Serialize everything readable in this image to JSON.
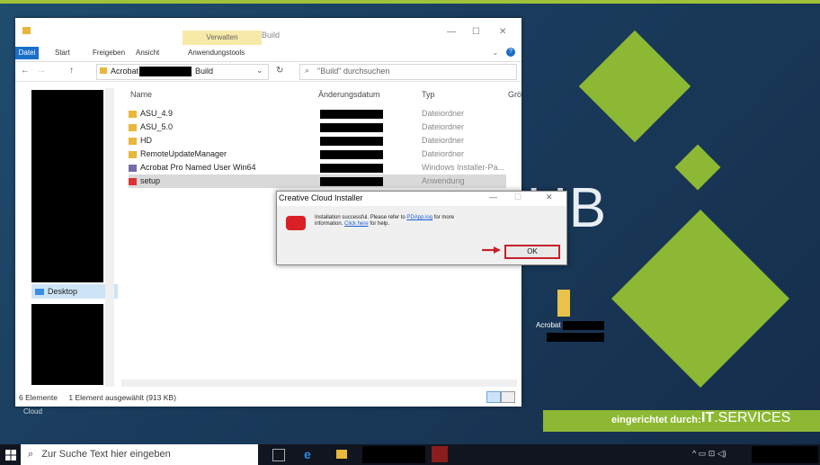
{
  "explorer": {
    "title": "Build",
    "manage_tab": "Verwalten",
    "tabs": [
      "Datei",
      "Start",
      "Freigeben",
      "Ansicht",
      "Anwendungstools"
    ],
    "address_root": "Acrobat",
    "address_current": "Build",
    "search_placeholder": "\"Build\" durchsuchen",
    "columns": {
      "name": "Name",
      "date": "Änderungsdatum",
      "type": "Typ",
      "size": "Grö"
    },
    "files": [
      {
        "name": "ASU_4.9",
        "type": "Dateiordner"
      },
      {
        "name": "ASU_5.0",
        "type": "Dateiordner"
      },
      {
        "name": "HD",
        "type": "Dateiordner"
      },
      {
        "name": "RemoteUpdateManager",
        "type": "Dateiordner"
      },
      {
        "name": "Acrobat Pro Named User Win64",
        "type": "Windows Installer-Pa..."
      },
      {
        "name": "setup",
        "type": "Anwendung"
      }
    ],
    "nav_desktop": "Desktop",
    "status_count": "6 Elemente",
    "status_selected": "1 Element ausgewählt (913 KB)",
    "behind_label": "Cloud"
  },
  "dialog": {
    "title": "Creative Cloud Installer",
    "message_prefix": "Installation successful. Please refer to ",
    "message_link1": "PDApp.log",
    "message_mid": " for more information. ",
    "message_link2": "Click here",
    "message_suffix": " for help.",
    "ok_label": "OK",
    "accent_color": "#c8202b"
  },
  "desktop": {
    "brand_letters": "UB",
    "icon_label": "Acrobat",
    "banner_label": "eingerichtet durch:",
    "banner_brand_bold": "IT",
    "banner_brand_rest": ".SERVICES",
    "accent_color": "#8db833"
  },
  "taskbar": {
    "search_placeholder": "Zur Suche Text hier eingeben"
  }
}
